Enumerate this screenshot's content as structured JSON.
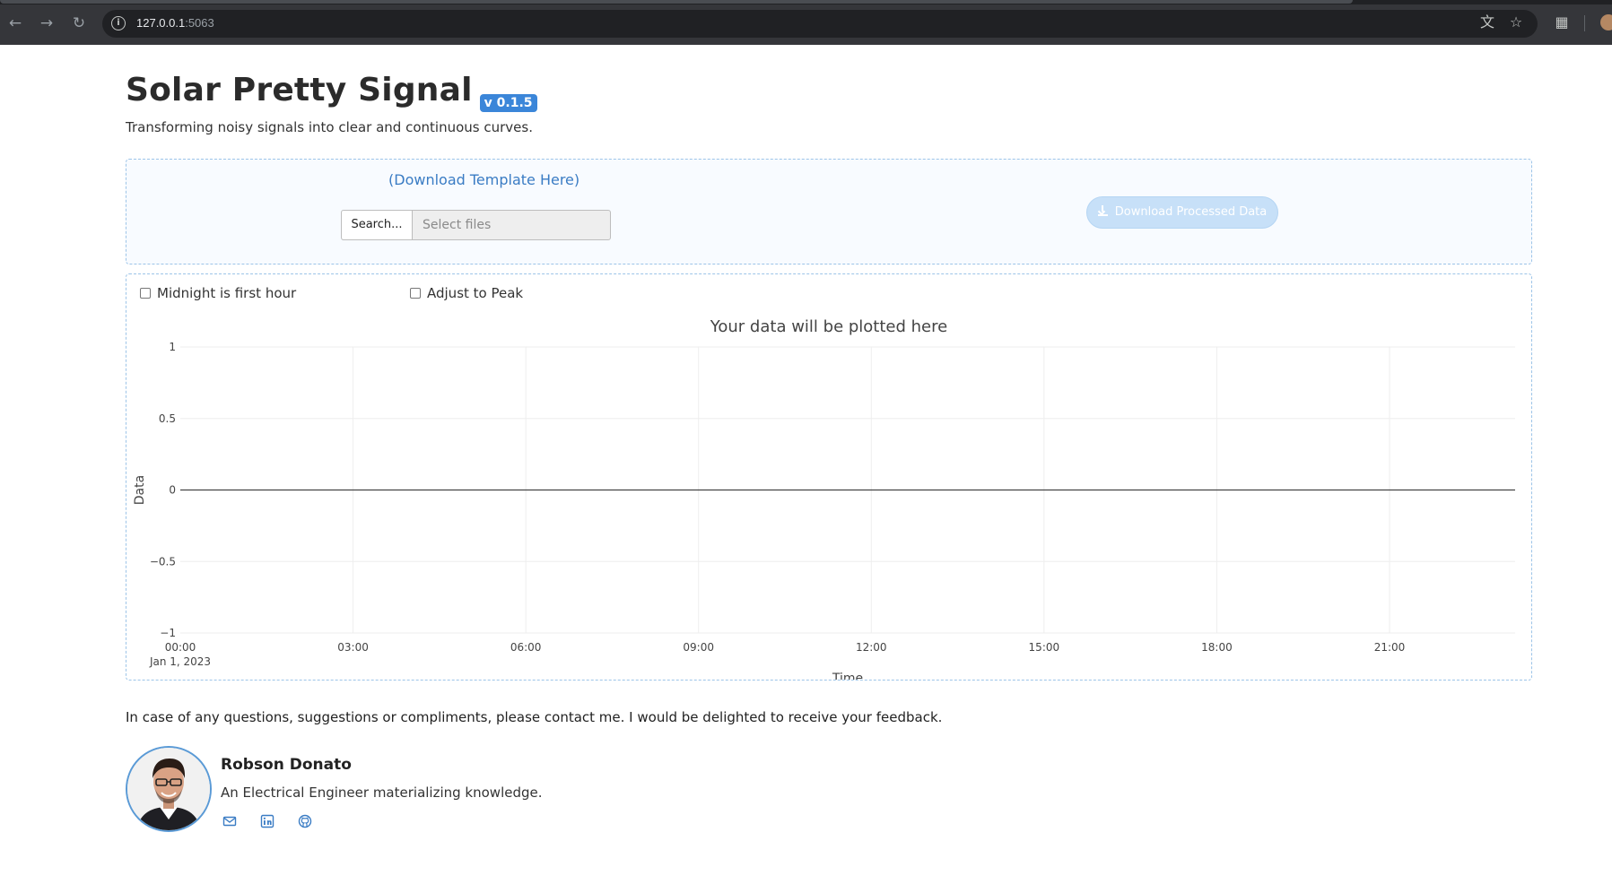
{
  "browser": {
    "url_host": "127.0.0.1",
    "url_port": ":5063",
    "back_icon": "arrow-left-icon",
    "forward_icon": "arrow-right-icon",
    "reload_icon": "reload-icon",
    "info_icon": "info-icon",
    "translate_icon": "translate-icon",
    "bookmark_icon": "star-icon",
    "extensions_icon": "puzzle-icon"
  },
  "header": {
    "title": "Solar Pretty Signal",
    "version": "v 0.1.5",
    "subtitle": "Transforming noisy signals into clear and continuous curves."
  },
  "upload": {
    "template_link": "(Download Template Here)",
    "browse_label": "Search...",
    "file_placeholder": "Select files",
    "download_label": "Download Processed Data",
    "download_icon": "download-icon"
  },
  "options": {
    "midnight_label": "Midnight is first hour",
    "midnight_checked": false,
    "peak_label": "Adjust to Peak",
    "peak_checked": false
  },
  "chart_data": {
    "type": "line",
    "title": "Your data will be plotted here",
    "xlabel": "Time",
    "ylabel": "Data",
    "x_ticks": [
      "00:00",
      "03:00",
      "06:00",
      "09:00",
      "12:00",
      "15:00",
      "18:00",
      "21:00"
    ],
    "x_date_label": "Jan 1, 2023",
    "y_ticks": [
      "1",
      "0.5",
      "0",
      "−0.5",
      "−1"
    ],
    "y_tick_values": [
      1,
      0.5,
      0,
      -0.5,
      -1
    ],
    "ylim": [
      -1,
      1
    ],
    "x_start_hour": 0,
    "x_end_hour": 23,
    "series": [],
    "grid": true
  },
  "contact": {
    "text": "In case of any questions, suggestions or compliments, please contact me. I would be delighted to receive your feedback.",
    "name": "Robson Donato",
    "description": "An Electrical Engineer materializing knowledge.",
    "email_icon": "email-icon",
    "linkedin_icon": "linkedin-icon",
    "github_icon": "github-icon"
  },
  "colors": {
    "accent": "#3b86d9",
    "link": "#3a7cc4",
    "panel_border": "#9cc4e8",
    "disabled_button": "#c7e0f8"
  }
}
